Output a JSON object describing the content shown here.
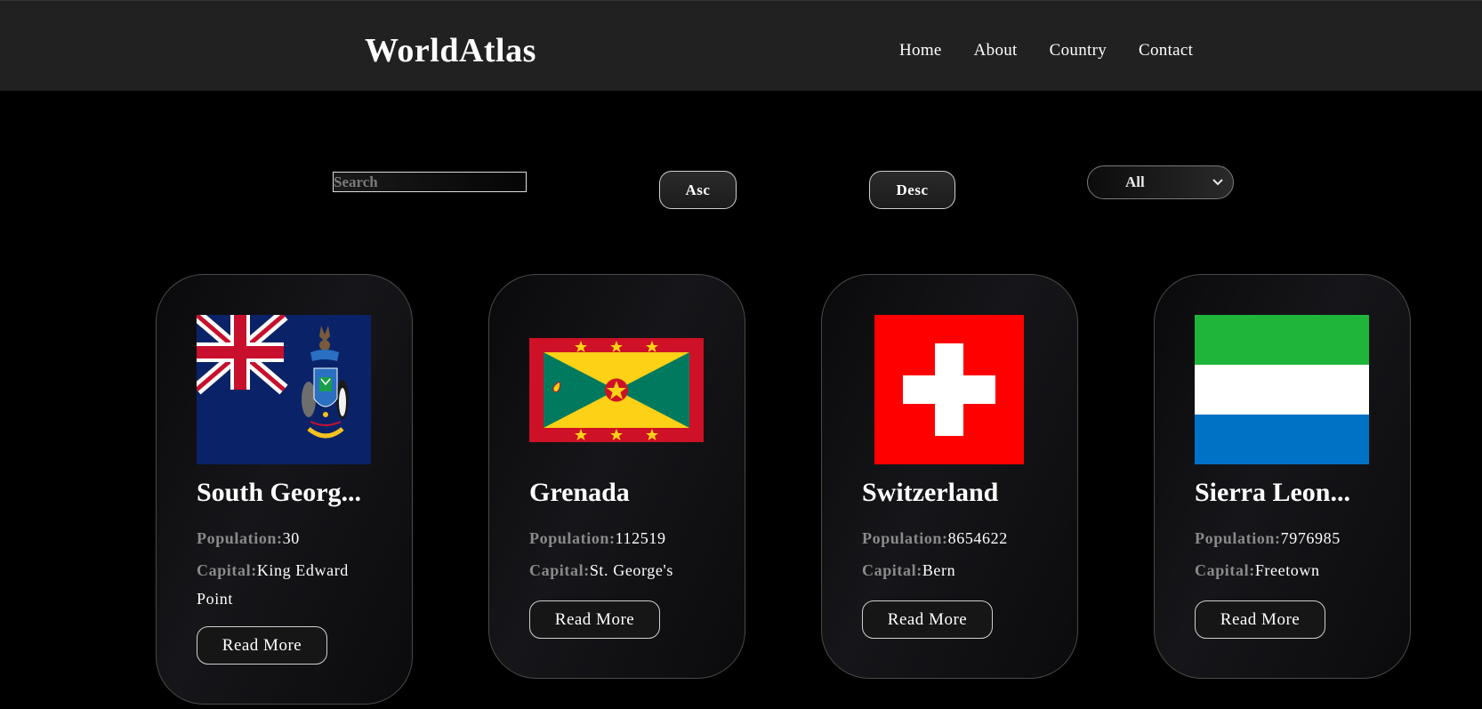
{
  "header": {
    "logo": "WorldAtlas",
    "nav": [
      {
        "label": "Home"
      },
      {
        "label": "About"
      },
      {
        "label": "Country"
      },
      {
        "label": "Contact"
      }
    ]
  },
  "controls": {
    "search_placeholder": "Search",
    "asc_label": "Asc",
    "desc_label": "Desc",
    "filter_value": "All"
  },
  "labels": {
    "population": "Population:",
    "capital": "Capital:",
    "read_more": "Read More"
  },
  "countries": [
    {
      "name": "South Georg...",
      "population": "30",
      "capital": "King Edward Point",
      "flag": "south-georgia-flag"
    },
    {
      "name": "Grenada",
      "population": "112519",
      "capital": "St. George's",
      "flag": "grenada-flag"
    },
    {
      "name": "Switzerland",
      "population": "8654622",
      "capital": "Bern",
      "flag": "switzerland-flag"
    },
    {
      "name": "Sierra Leon...",
      "population": "7976985",
      "capital": "Freetown",
      "flag": "sierra-leone-flag"
    }
  ],
  "colors": {
    "header_bg": "#212121",
    "page_bg": "#000000",
    "label_gray": "#8a8a8a",
    "button_border": "#cfcfcf"
  }
}
